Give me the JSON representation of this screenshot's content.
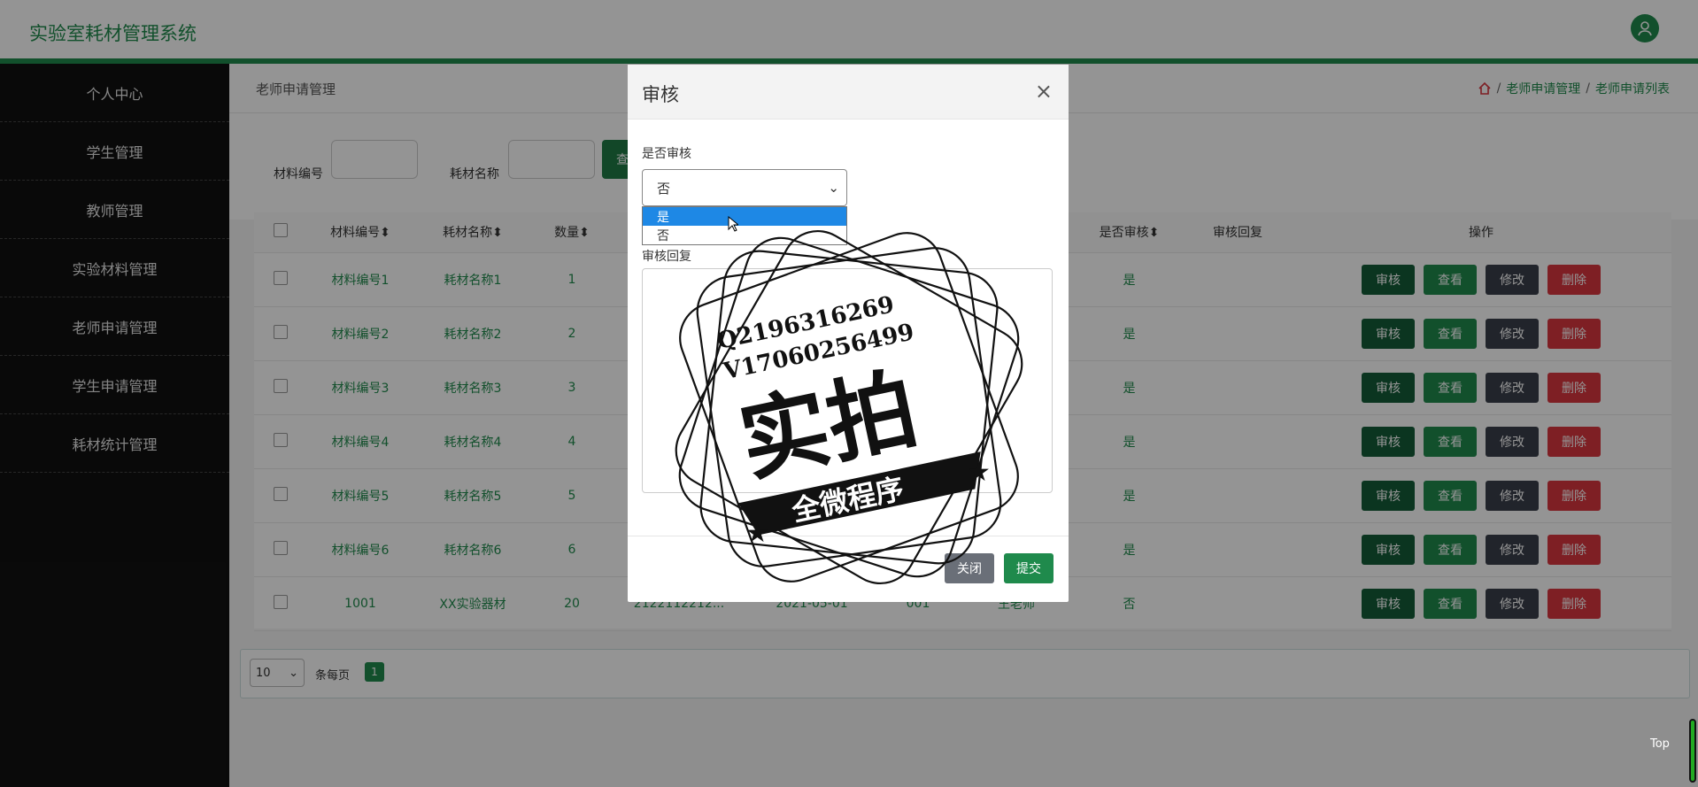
{
  "header": {
    "title": "实验室耗材管理系统"
  },
  "sidebar": {
    "items": [
      {
        "label": "个人中心"
      },
      {
        "label": "学生管理"
      },
      {
        "label": "教师管理"
      },
      {
        "label": "实验材料管理"
      },
      {
        "label": "老师申请管理"
      },
      {
        "label": "学生申请管理"
      },
      {
        "label": "耗材统计管理"
      }
    ]
  },
  "breadcrumb": {
    "left": "老师申请管理",
    "items": [
      "老师申请管理",
      "老师申请列表"
    ]
  },
  "search": {
    "label1": "材料编号",
    "label2": "耗材名称",
    "button": "查询"
  },
  "table": {
    "headers": {
      "code": "材料编号",
      "name": "耗材名称",
      "qty": "数量",
      "audited": "是否审核",
      "reply": "审核回复",
      "ops": "操作"
    },
    "rows": [
      {
        "code": "材料编号1",
        "name": "耗材名称1",
        "qty": "1",
        "audited": "是"
      },
      {
        "code": "材料编号2",
        "name": "耗材名称2",
        "qty": "2",
        "audited": "是"
      },
      {
        "code": "材料编号3",
        "name": "耗材名称3",
        "qty": "3",
        "audited": "是"
      },
      {
        "code": "材料编号4",
        "name": "耗材名称4",
        "qty": "4",
        "audited": "是"
      },
      {
        "code": "材料编号5",
        "name": "耗材名称5",
        "qty": "5",
        "audited": "是"
      },
      {
        "code": "材料编号6",
        "name": "耗材名称6",
        "qty": "6",
        "audited": "是"
      },
      {
        "code": "1001",
        "name": "XX实验器材",
        "qty": "20",
        "audited": "否"
      }
    ],
    "row7_extra": {
      "c1": "2122112212...",
      "c2": "2021-05-01",
      "c3": "001",
      "c4": "王老师"
    },
    "op_labels": {
      "audit": "审核",
      "view": "查看",
      "edit": "修改",
      "delete": "删除"
    }
  },
  "pager": {
    "page_size": "10",
    "per_page_label": "条每页",
    "current": "1"
  },
  "top_label": "Top",
  "modal": {
    "title": "审核",
    "close_symbol": "×",
    "field_audited": "是否审核",
    "selected": "否",
    "options": [
      "是",
      "否"
    ],
    "field_reply": "审核回复",
    "close_btn": "关闭",
    "submit_btn": "提交"
  },
  "stamp": {
    "line1": "Q2196316269",
    "line2": "V17060256499",
    "big": "实拍",
    "banner": "全微程序"
  },
  "colors": {
    "brand": "#1f8a4c",
    "danger": "#d9363e",
    "dark": "#3a3f4a"
  }
}
